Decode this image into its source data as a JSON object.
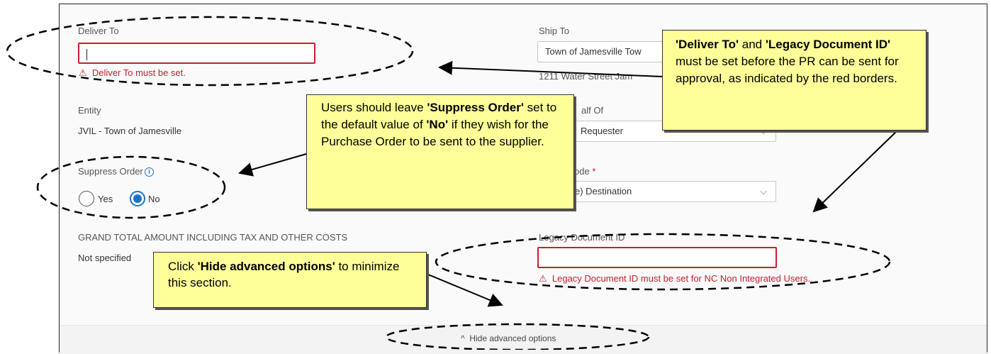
{
  "form": {
    "deliver_to": {
      "label": "Deliver To",
      "value": "",
      "error": "Deliver To must be set."
    },
    "ship_to": {
      "label": "Ship To",
      "value": "Town of Jamesville Tow",
      "address": "1211 Water Street Jam"
    },
    "entity": {
      "label": "Entity",
      "value": "JVIL - Town of Jamesville"
    },
    "on_behalf_of": {
      "label": "alf Of",
      "value": "Requester"
    },
    "suppress_order": {
      "label": "Suppress Order",
      "options": [
        "Yes",
        "No"
      ],
      "selected": "No"
    },
    "freight_code": {
      "label": "ode",
      "required_marker": "*",
      "value": "e) Destination"
    },
    "grand_total": {
      "label": "GRAND TOTAL AMOUNT INCLUDING TAX AND OTHER COSTS",
      "value": "Not specified"
    },
    "legacy_document_id": {
      "label": "Legacy Document ID",
      "value": "",
      "error": "Legacy Document ID must be set for NC Non Integrated Users."
    },
    "hide_advanced": {
      "label": "Hide advanced options"
    }
  },
  "icons": {
    "warning": "⚠",
    "info": "i",
    "chevron_down": "⌵",
    "chevron_up": "^"
  },
  "callouts": {
    "deliver_legacy": {
      "b1": "'Deliver To'",
      "t1": " and ",
      "b2": "'Legacy Document ID'",
      "t2": " must be set before the PR can be sent for approval, as indicated by the red borders."
    },
    "suppress": {
      "t1": "Users should leave ",
      "b1": "'Suppress Order'",
      "t2": " set to the default value of ",
      "b2": "'No'",
      "t3": " if they wish for the Purchase Order to be sent to the supplier."
    },
    "hide": {
      "t1": "Click ",
      "b1": "'Hide advanced options'",
      "t2": " to minimize this section."
    }
  },
  "colors": {
    "error": "#c0202c",
    "accent": "#1a73c8",
    "callout_bg": "#ffff99"
  }
}
